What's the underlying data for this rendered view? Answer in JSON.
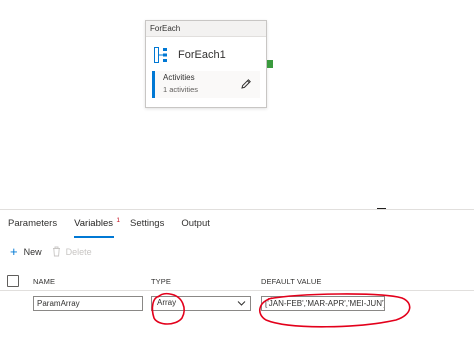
{
  "canvas": {
    "activity": {
      "header": "ForEach",
      "name": "ForEach1",
      "activities_label": "Activities",
      "activities_count": "1 activities"
    }
  },
  "panel": {
    "tabs": [
      {
        "label": "Parameters"
      },
      {
        "label": "Variables",
        "badge": "1",
        "active": true
      },
      {
        "label": "Settings"
      },
      {
        "label": "Output"
      }
    ],
    "toolbar": {
      "new_label": "New",
      "delete_label": "Delete"
    },
    "grid": {
      "headers": [
        "NAME",
        "TYPE",
        "DEFAULT VALUE"
      ],
      "rows": [
        {
          "name": "ParamArray",
          "type": "Array",
          "default_value": "['JAN-FEB','MAR-APR','MEI-JUN']"
        }
      ]
    }
  },
  "colors": {
    "accent": "#0078d4",
    "success": "#3a9a3d",
    "annotation": "#e3001b"
  },
  "icons": [
    "foreach-icon",
    "pencil-icon",
    "plus-icon",
    "trash-icon",
    "chevron-down-icon"
  ]
}
